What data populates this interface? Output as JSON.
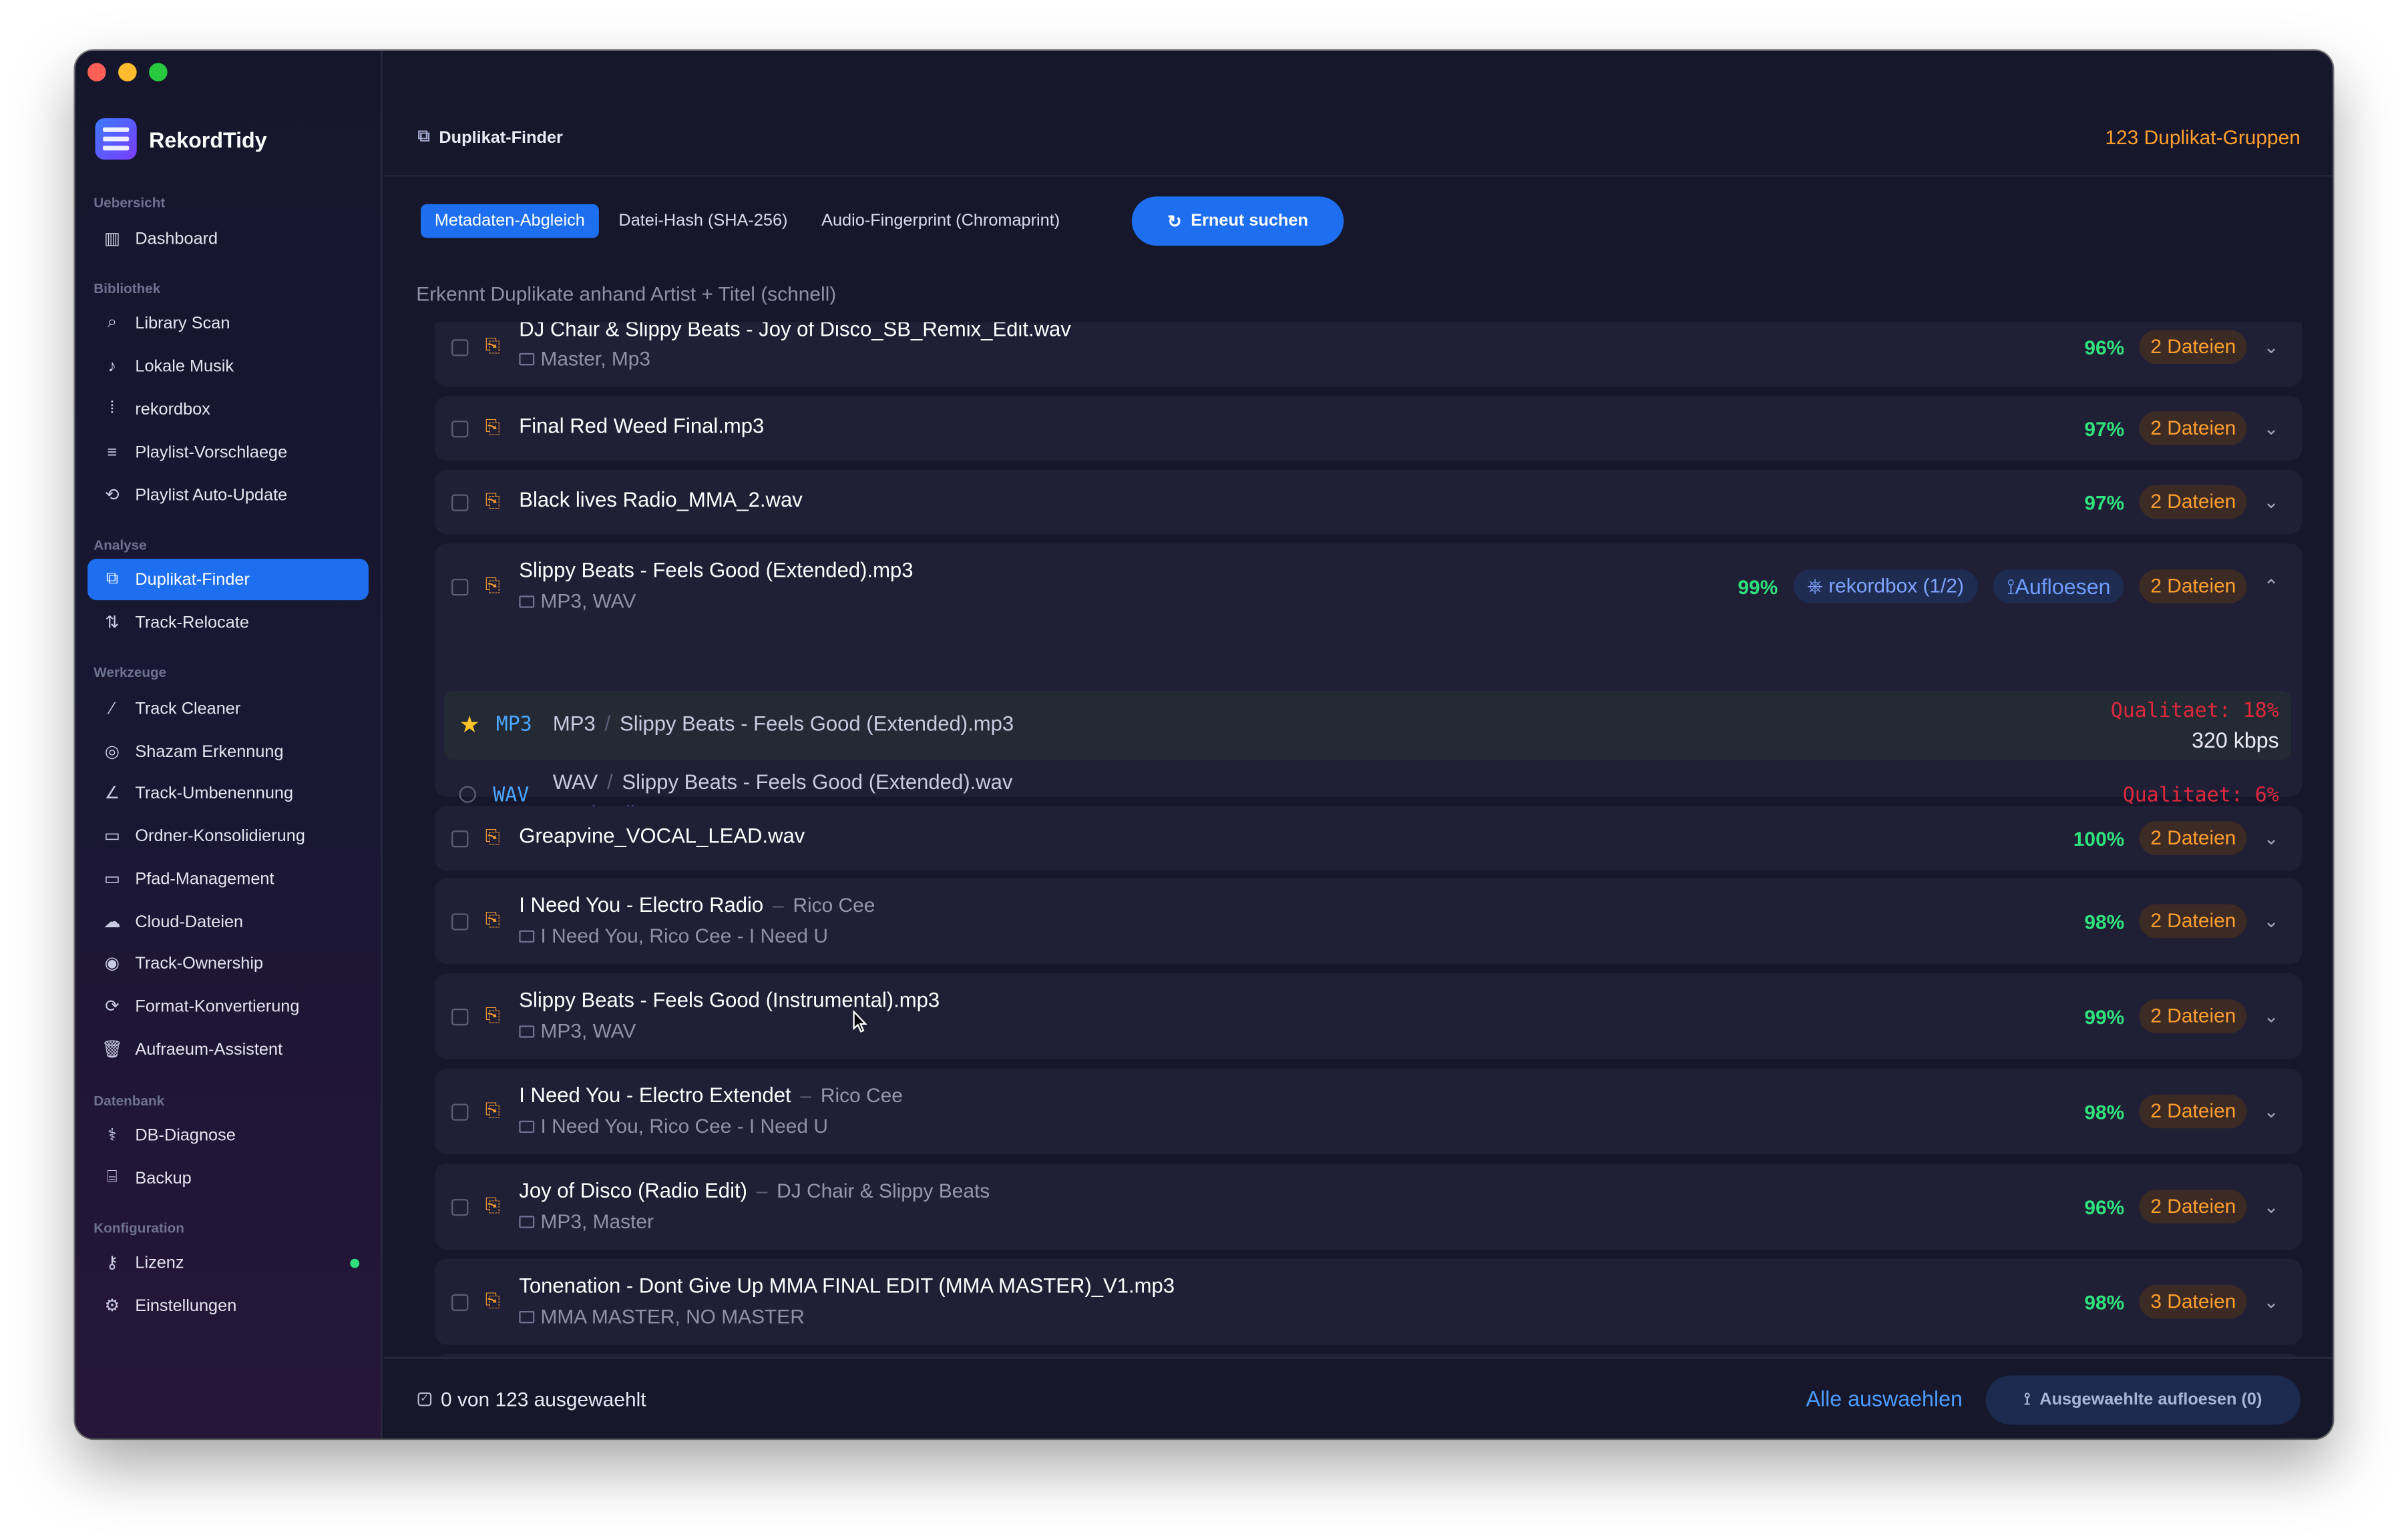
{
  "app": {
    "name": "RekordTidy"
  },
  "sidebar": {
    "sections": [
      {
        "title": "Uebersicht",
        "items": [
          {
            "label": "Dashboard",
            "icon": "bar-chart-icon"
          }
        ]
      },
      {
        "title": "Bibliothek",
        "items": [
          {
            "label": "Library Scan",
            "icon": "search-icon"
          },
          {
            "label": "Lokale Musik",
            "icon": "music-note-icon"
          },
          {
            "label": "rekordbox",
            "icon": "waveform-icon"
          },
          {
            "label": "Playlist-Vorschlaege",
            "icon": "playlist-icon"
          },
          {
            "label": "Playlist Auto-Update",
            "icon": "repeat-icon"
          }
        ]
      },
      {
        "title": "Analyse",
        "items": [
          {
            "label": "Duplikat-Finder",
            "icon": "duplicate-icon",
            "active": true
          },
          {
            "label": "Track-Relocate",
            "icon": "relocate-icon"
          }
        ]
      },
      {
        "title": "Werkzeuge",
        "items": [
          {
            "label": "Track Cleaner",
            "icon": "magic-wand-icon"
          },
          {
            "label": "Shazam Erkennung",
            "icon": "shazam-icon"
          },
          {
            "label": "Track-Umbenennung",
            "icon": "pencil-icon"
          },
          {
            "label": "Ordner-Konsolidierung",
            "icon": "folder-icon"
          },
          {
            "label": "Pfad-Management",
            "icon": "folder-path-icon"
          },
          {
            "label": "Cloud-Dateien",
            "icon": "cloud-icon"
          },
          {
            "label": "Track-Ownership",
            "icon": "user-circle-icon"
          },
          {
            "label": "Format-Konvertierung",
            "icon": "convert-icon"
          },
          {
            "label": "Aufraeum-Assistent",
            "icon": "trash-icon"
          }
        ]
      },
      {
        "title": "Datenbank",
        "items": [
          {
            "label": "DB-Diagnose",
            "icon": "stethoscope-icon"
          },
          {
            "label": "Backup",
            "icon": "drive-icon"
          }
        ]
      },
      {
        "title": "Konfiguration",
        "items": [
          {
            "label": "Lizenz",
            "icon": "key-icon",
            "status_dot": "#2fe07a"
          },
          {
            "label": "Einstellungen",
            "icon": "gear-icon"
          }
        ]
      }
    ]
  },
  "header": {
    "title": "Duplikat-Finder",
    "count": "123 Duplikat-Gruppen"
  },
  "modes": {
    "tabs": [
      "Metadaten-Abgleich",
      "Datei-Hash (SHA-256)",
      "Audio-Fingerprint (Chromaprint)"
    ],
    "active_index": 0,
    "rescan_label": "Erneut suchen",
    "description": "Erkennt Duplikate anhand Artist + Titel (schnell)"
  },
  "groups": [
    {
      "title": "DJ Chair & Slippy Beats - Joy of Disco_SB_Remix_Edit.wav",
      "artist": "",
      "sub": "Master, Mp3",
      "pct": "96%",
      "files": "2 Dateien"
    },
    {
      "title": "Final Red Weed Final.mp3",
      "artist": "",
      "sub": "",
      "pct": "97%",
      "files": "2 Dateien"
    },
    {
      "title": "Black lives Radio_MMA_2.wav",
      "artist": "",
      "sub": "",
      "pct": "97%",
      "files": "2 Dateien"
    },
    {
      "title": "Slippy Beats - Feels Good (Extended).mp3",
      "artist": "",
      "sub": "MP3, WAV",
      "pct": "99%",
      "files": "2 Dateien",
      "expanded": true,
      "rekordbox_pill": "rekordbox (1/2)",
      "resolve_label": "Aufloesen",
      "entries": [
        {
          "format": "MP3",
          "folder": "MP3",
          "file": "Slippy Beats - Feels Good (Extended).mp3",
          "quality": "Qualitaet: 18%",
          "bitrate": "320 kbps",
          "starred": true
        },
        {
          "format": "WAV",
          "folder": "WAV",
          "file": "Slippy Beats - Feels Good (Extended).wav",
          "quality": "Qualitaet: 6%",
          "source": "rekordbox",
          "starred": false
        }
      ]
    },
    {
      "title": "Greapvine_VOCAL_LEAD.wav",
      "artist": "",
      "sub": "",
      "pct": "100%",
      "files": "2 Dateien"
    },
    {
      "title": "I Need You - Electro Radio",
      "artist": "Rico Cee",
      "sub": "I Need You, Rico Cee - I Need U",
      "pct": "98%",
      "files": "2 Dateien"
    },
    {
      "title": "Slippy Beats - Feels Good (Instrumental).mp3",
      "artist": "",
      "sub": "MP3, WAV",
      "pct": "99%",
      "files": "2 Dateien"
    },
    {
      "title": "I Need You - Electro Extendet",
      "artist": "Rico Cee",
      "sub": "I Need You, Rico Cee - I Need U",
      "pct": "98%",
      "files": "2 Dateien"
    },
    {
      "title": "Joy of Disco (Radio Edit)",
      "artist": "DJ Chair & Slippy Beats",
      "sub": "MP3, Master",
      "pct": "96%",
      "files": "2 Dateien"
    },
    {
      "title": "Tonenation - Dont Give Up MMA FINAL EDIT (MMA MASTER)_V1.mp3",
      "artist": "",
      "sub": "MMA MASTER, NO MASTER",
      "pct": "98%",
      "files": "3 Dateien"
    }
  ],
  "footer": {
    "selection": "0 von 123 ausgewaehlt",
    "select_all": "Alle auswaehlen",
    "resolve_selected": "Ausgewaehlte aufloesen (0)"
  },
  "colors": {
    "accent": "#1d6ff0",
    "orange": "#ff9f2e",
    "green": "#30e27c",
    "quality_red": "#e0283c",
    "format_blue": "#4aa6ff"
  }
}
